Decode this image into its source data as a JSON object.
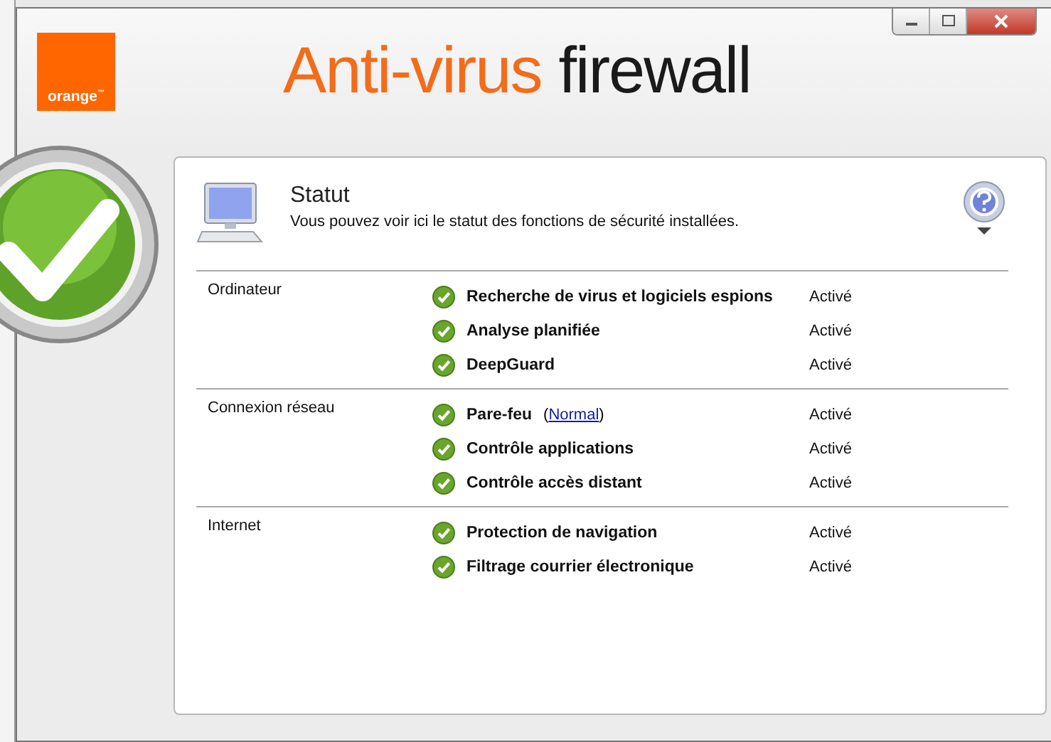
{
  "logo": {
    "text": "orange",
    "mark": "™"
  },
  "title": [
    {
      "text": "Anti-virus",
      "kind": "accent"
    },
    {
      "text": "firewall",
      "kind": "plain"
    }
  ],
  "panel": {
    "title": "Statut",
    "subtitle": "Vous pouvez voir ici le statut des fonctions de sécurité installées."
  },
  "sections": [
    {
      "label": "Ordinateur",
      "items": [
        {
          "name": "Recherche de virus et logiciels espions",
          "status": "Activé",
          "ok": true
        },
        {
          "name": "Analyse planifiée",
          "status": "Activé",
          "ok": true
        },
        {
          "name": "DeepGuard",
          "status": "Activé",
          "ok": true
        }
      ]
    },
    {
      "label": "Connexion réseau",
      "items": [
        {
          "name": "Pare-feu",
          "link_open": "(",
          "link": "Normal",
          "link_close": ")",
          "status": "Activé",
          "ok": true
        },
        {
          "name": "Contrôle applications",
          "status": "Activé",
          "ok": true
        },
        {
          "name": "Contrôle accès distant",
          "status": "Activé",
          "ok": true
        }
      ]
    },
    {
      "label": "Internet",
      "items": [
        {
          "name": "Protection de navigation",
          "status": "Activé",
          "ok": true
        },
        {
          "name": "Filtrage courrier électronique",
          "status": "Activé",
          "ok": true
        }
      ]
    }
  ]
}
